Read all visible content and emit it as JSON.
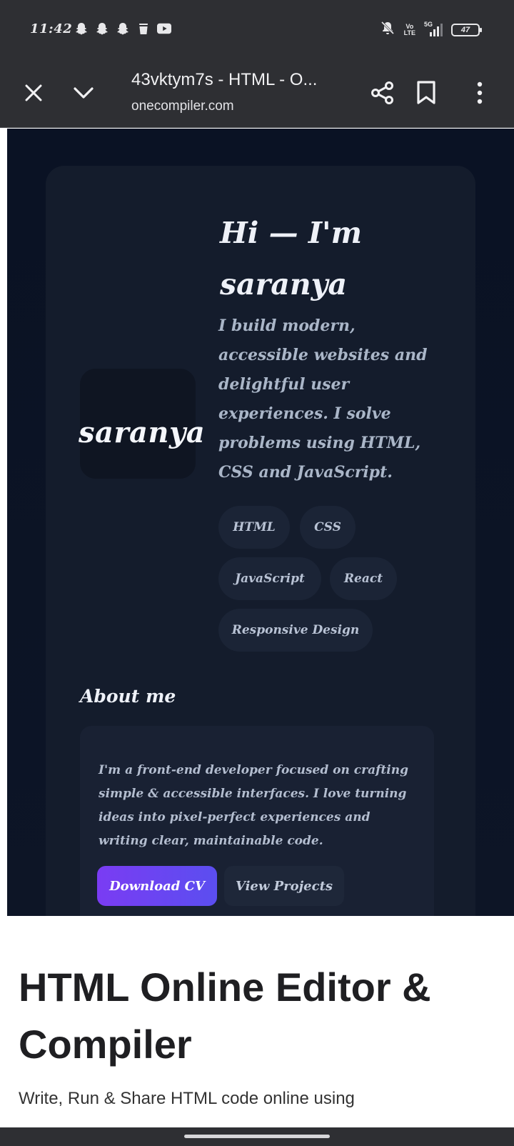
{
  "status_bar": {
    "time": "11:42",
    "notification_icons": [
      "snapchat-icon",
      "snapchat-icon",
      "snapchat-icon",
      "cup-icon",
      "youtube-icon"
    ],
    "network": "5G",
    "volte": "Vo\nLTE",
    "battery": "47"
  },
  "browser": {
    "title": "43vktym7s - HTML - O...",
    "url": "onecompiler.com"
  },
  "preview": {
    "avatar_name": "saranya",
    "hero_title": "Hi — I'm saranya",
    "hero_subtitle": "I build modern, accessible websites and delightful user experiences. I solve problems using HTML, CSS and JavaScript.",
    "tags": [
      "HTML",
      "CSS",
      "JavaScript",
      "React",
      "Responsive Design"
    ],
    "about_heading": "About me",
    "about_text": "I'm a front-end developer focused on crafting simple & accessible interfaces. I love turning ideas into pixel-perfect experiences and writing clear, maintainable code.",
    "download_cv": "Download CV",
    "view_projects": "View Projects"
  },
  "page": {
    "heading": "HTML Online Editor & Compiler",
    "paragraph": "Write, Run & Share HTML code online using"
  },
  "colors": {
    "chrome": "#2e2f33",
    "preview_bg": "#0a1224",
    "card_bg": "#141c2c",
    "accent_purple": "#7a3cf3"
  }
}
